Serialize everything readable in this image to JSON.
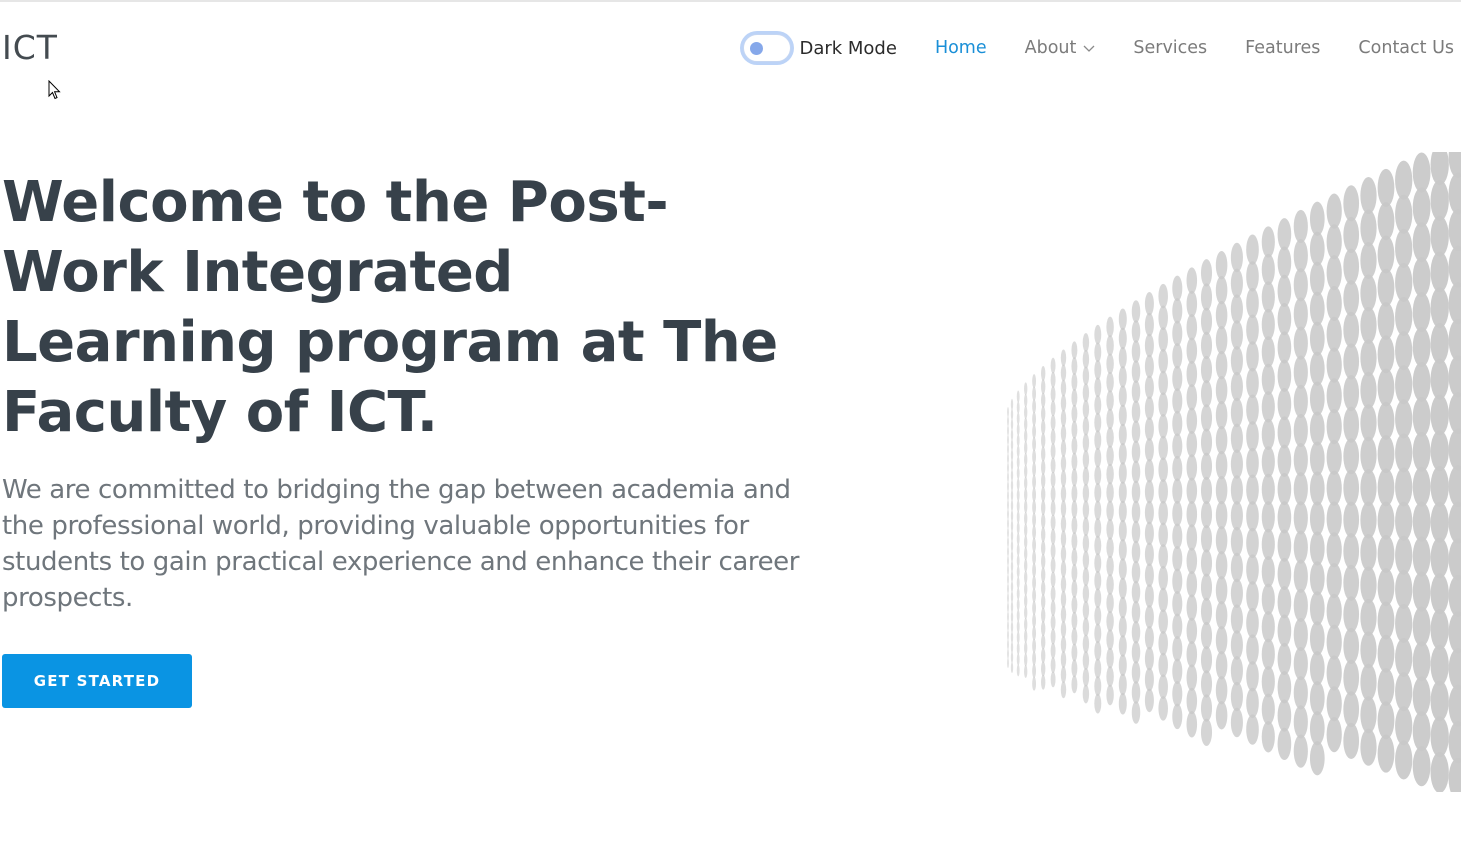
{
  "header": {
    "logo": "ICT",
    "dark_mode_label": "Dark Mode",
    "nav": [
      {
        "label": "Home",
        "active": true
      },
      {
        "label": "About",
        "has_dropdown": true
      },
      {
        "label": "Services"
      },
      {
        "label": "Features"
      },
      {
        "label": "Contact Us"
      }
    ]
  },
  "hero": {
    "title": "Welcome to the Post-Work Integrated Learning program at The Faculty of ICT.",
    "subtitle": "We are committed to bridging the gap between academia and the professional world, providing valuable opportunities for students to gain practical experience and enhance their career prospects.",
    "cta_label": "GET STARTED"
  },
  "colors": {
    "accent": "#1a8fd7",
    "button": "#0a94e3",
    "title": "#37414a",
    "text": "#6f767c",
    "dots": "#c8c8c8"
  },
  "icons": {
    "dropdown": "chevron-down-icon",
    "toggle": "toggle-switch-icon",
    "cursor": "mouse-cursor-icon",
    "hero_art": "dot-wave-pattern"
  }
}
